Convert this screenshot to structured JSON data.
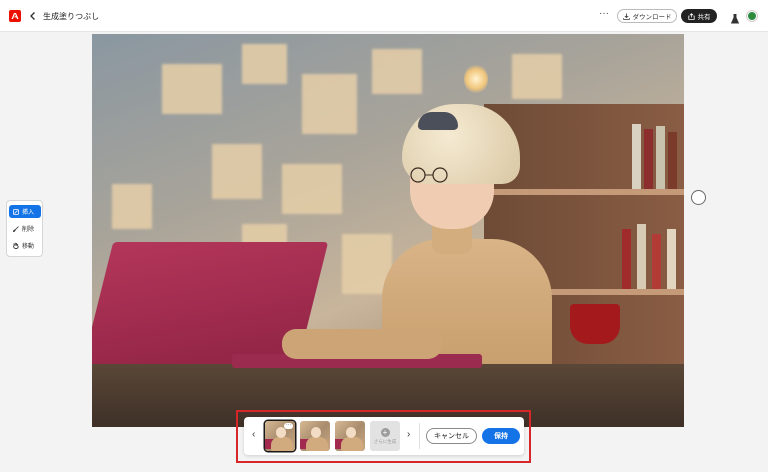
{
  "app": {
    "title": "生成塗りつぶし"
  },
  "header": {
    "more_label": "···",
    "download_label": "ダウンロード",
    "share_label": "共有"
  },
  "tools": {
    "items": [
      {
        "label": "挿入",
        "icon": "insert-icon",
        "active": true
      },
      {
        "label": "削除",
        "icon": "brush-icon",
        "active": false
      },
      {
        "label": "移動",
        "icon": "hand-icon",
        "active": false
      }
    ]
  },
  "variants": {
    "prev_label": "‹",
    "next_label": "›",
    "thumbs": [
      {
        "selected": true,
        "menu_label": "···"
      },
      {
        "selected": false
      },
      {
        "selected": false
      }
    ],
    "more_label": "さらに生成",
    "cancel_label": "キャンセル",
    "keep_label": "保持"
  },
  "colors": {
    "accent": "#1473e6",
    "brand": "#eb1000",
    "highlight": "#d7262a"
  }
}
